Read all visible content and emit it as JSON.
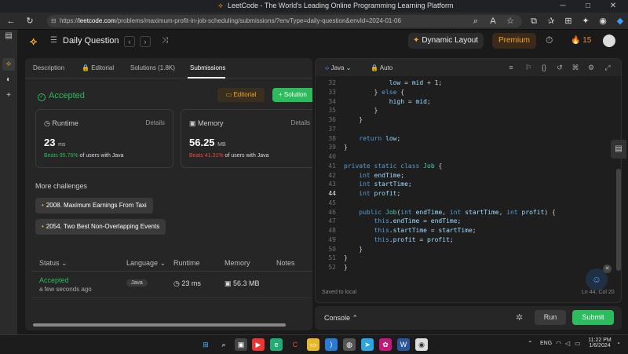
{
  "browser": {
    "tab_title": "LeetCode - The World's Leading Online Programming Learning Platform",
    "url_prefix": "https://",
    "url_host": "leetcode.com",
    "url_path": "/problems/maximum-profit-in-job-scheduling/submissions/?envType=daily-question&envId=2024-01-06"
  },
  "header": {
    "daily_label": "Daily Question",
    "dynamic_layout": "Dynamic Layout",
    "premium": "Premium",
    "streak": "15"
  },
  "tabs": {
    "description": "Description",
    "editorial": "Editorial",
    "solutions": "Solutions (1.8K)",
    "submissions": "Submissions"
  },
  "result": {
    "status": "Accepted",
    "editorial_btn": "Editorial",
    "solution_btn": "Solution"
  },
  "runtime": {
    "label": "Runtime",
    "details": "Details",
    "value": "23",
    "unit": "ms",
    "beats_prefix": "Beats 95.76%",
    "beats_suffix": "of users with Java"
  },
  "memory": {
    "label": "Memory",
    "details": "Details",
    "value": "56.25",
    "unit": "MB",
    "beats_prefix": "Beats 41.31%",
    "beats_suffix": "of users with Java"
  },
  "challenges": {
    "title": "More challenges",
    "items": [
      "2008. Maximum Earnings From Taxi",
      "2054. Two Best Non-Overlapping Events"
    ]
  },
  "submissions_table": {
    "headers": {
      "status": "Status",
      "language": "Language",
      "runtime": "Runtime",
      "memory": "Memory",
      "notes": "Notes"
    },
    "row": {
      "status": "Accepted",
      "time": "a few seconds ago",
      "language": "Java",
      "runtime": "23 ms",
      "memory": "56.3 MB"
    }
  },
  "editor": {
    "language": "Java",
    "mode": "Auto",
    "saved": "Saved to local",
    "cursor": "Ln 44, Col 20",
    "current_line": 44,
    "lines": [
      {
        "n": 32,
        "code": "            low = mid + 1;"
      },
      {
        "n": 33,
        "code": "        } else {"
      },
      {
        "n": 34,
        "code": "            high = mid;"
      },
      {
        "n": 35,
        "code": "        }"
      },
      {
        "n": 36,
        "code": "    }"
      },
      {
        "n": 37,
        "code": ""
      },
      {
        "n": 38,
        "code": "    return low;"
      },
      {
        "n": 39,
        "code": "}"
      },
      {
        "n": 40,
        "code": ""
      },
      {
        "n": 41,
        "code": "private static class Job {"
      },
      {
        "n": 42,
        "code": "    int endTime;"
      },
      {
        "n": 43,
        "code": "    int startTime;"
      },
      {
        "n": 44,
        "code": "    int profit;"
      },
      {
        "n": 45,
        "code": ""
      },
      {
        "n": 46,
        "code": "    public Job(int endTime, int startTime, int profit) {"
      },
      {
        "n": 47,
        "code": "        this.endTime = endTime;"
      },
      {
        "n": 48,
        "code": "        this.startTime = startTime;"
      },
      {
        "n": 49,
        "code": "        this.profit = profit;"
      },
      {
        "n": 50,
        "code": "    }"
      },
      {
        "n": 51,
        "code": "}"
      },
      {
        "n": 52,
        "code": "}"
      }
    ]
  },
  "console": {
    "label": "Console",
    "run": "Run",
    "submit": "Submit"
  },
  "taskbar": {
    "lang": "ENG",
    "time": "11:22 PM",
    "date": "1/6/2024"
  },
  "colors": {
    "accent_green": "#2cbb5d",
    "accent_orange": "#f5a623",
    "bg": "#1a1a1a",
    "panel": "#262626"
  }
}
